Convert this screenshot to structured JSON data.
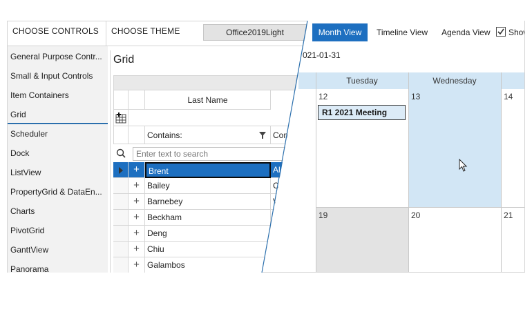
{
  "header": {
    "choose_controls": "CHOOSE CONTROLS",
    "choose_theme": "CHOOSE THEME",
    "theme_value": "Office2019Light"
  },
  "nav": {
    "items": [
      "General Purpose Contr...",
      "Small & Input Controls",
      "Item Containers",
      "Grid",
      "Scheduler",
      "Dock",
      "ListView",
      "PropertyGrid & DataEn...",
      "Charts",
      "PivotGrid",
      "GanttView",
      "Panorama"
    ],
    "selected": "Grid"
  },
  "grid": {
    "title": "Grid",
    "column_last_name": "Last Name",
    "filter_text": "Contains:",
    "next_col_header_partial": "Con",
    "search_placeholder": "Enter text to search",
    "rows": [
      {
        "name": "Brent",
        "next": "Al"
      },
      {
        "name": "Bailey",
        "next": "C"
      },
      {
        "name": "Barnebey",
        "next": "V"
      },
      {
        "name": "Beckham",
        "next": ""
      },
      {
        "name": "Deng",
        "next": ""
      },
      {
        "name": "Chiu",
        "next": ""
      },
      {
        "name": "Galambos",
        "next": ""
      }
    ]
  },
  "scheduler": {
    "views": {
      "month": "Month View",
      "timeline": "Timeline View",
      "agenda": "Agenda View",
      "show_partial": "Show"
    },
    "date_label": "021-01-31",
    "days": [
      "Tuesday",
      "Wednesday"
    ],
    "week1": [
      "12",
      "13",
      "14"
    ],
    "week2": [
      "19",
      "20",
      "21"
    ],
    "appointment": "R1 2021 Meeting"
  },
  "colors": {
    "accent": "#1d6fc0",
    "selected_cell": "#d2e6f5",
    "disabled_cell": "#e3e3e3"
  }
}
